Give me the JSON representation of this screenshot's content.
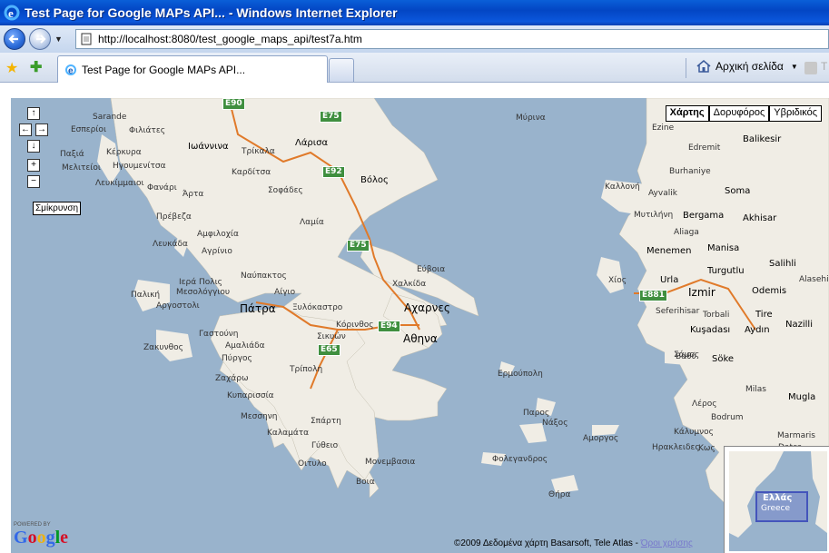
{
  "window": {
    "title": "Test Page for Google MAPs API... - Windows Internet Explorer",
    "address": "http://localhost:8080/test_google_maps_api/test7a.htm"
  },
  "tabs": [
    {
      "label": "Test Page for Google MAPs API..."
    }
  ],
  "toolbar": {
    "home_label": "Αρχική σελίδα",
    "cut_label": "Τ"
  },
  "map": {
    "controls": {
      "zoom_out_tooltip": "Σμίκρυνση"
    },
    "map_types": [
      "Χάρτης",
      "Δορυφόρος",
      "Υβριδικός"
    ],
    "active_map_type": "Χάρτης",
    "copyright": "©2009 Δεδομένα χάρτη Basarsoft, Tele Atlas - ",
    "terms_link": "Όροι χρήσης",
    "powered_by": "POWERED BY",
    "google_logo": "Google",
    "overview": {
      "label1": "Ελλάς",
      "label2": "Greece"
    },
    "labels": [
      "Sarande",
      "Εσπερίοι",
      "Φιλιάτες",
      "Ιωάννινα",
      "Τρίκαλα",
      "Λάρισα",
      "Βόλος",
      "Παξιά",
      "Κέρκυρα",
      "Ηγουμενίτσα",
      "Καρδίτσα",
      "Μελιτείοι",
      "Λευκίμμαιοι",
      "Φανάρι",
      "Άρτα",
      "Σοφάδες",
      "Πρέβεζα",
      "Λαμία",
      "Αμφιλοχία",
      "Λευκάδα",
      "Αγρίνιο",
      "Εύβοια",
      "Χαλκίδα",
      "Ιερά Πολις",
      "Μεσολόγγιου",
      "Ναύπακτος",
      "Αίγιο",
      "Παλική",
      "Αργοστολι",
      "Πάτρα",
      "Ξυλόκαστρο",
      "Κόρινθος",
      "Σικυών",
      "Αχαρνες",
      "Αθηνα",
      "Γαστούνη",
      "Αμαλιάδα",
      "Ζακυνθος",
      "Πύργος",
      "Τρίπολη",
      "Ζαχάρω",
      "Κυπαρισσία",
      "Μεσσηνη",
      "Καλαμάτα",
      "Σπάρτη",
      "Γύθειο",
      "Οιτυλο",
      "Μονεμβασια",
      "Βοια",
      "Ερμούπολη",
      "Νάξος",
      "Παρος",
      "Αμοργος",
      "Φολεγανδρος",
      "Θήρα",
      "Μύρινα",
      "Χίος",
      "Σάμος",
      "Λέρος",
      "Κάλυμνος",
      "Ηρακλειδες",
      "Κως",
      "Ezine",
      "Edremit",
      "Balikesir",
      "Burhaniye",
      "Kαλλονή",
      "Ayvalik",
      "Soma",
      "Μυτιλήνη",
      "Bergama",
      "Akhisar",
      "Aliaga",
      "Menemen",
      "Manisa",
      "Turgutlu",
      "Salihli",
      "Urla",
      "Izmir",
      "Seferihisar",
      "Torbali",
      "Tire",
      "Odemis",
      "Alasehir",
      "Kuşadası",
      "Aydın",
      "Nazilli",
      "Söke",
      "Bodrum",
      "Milas",
      "Mugla",
      "Marmaris",
      "Datça",
      "Βαθύ"
    ],
    "roads": [
      "E90",
      "E75",
      "E92",
      "E75",
      "E94",
      "E65",
      "E881"
    ]
  }
}
